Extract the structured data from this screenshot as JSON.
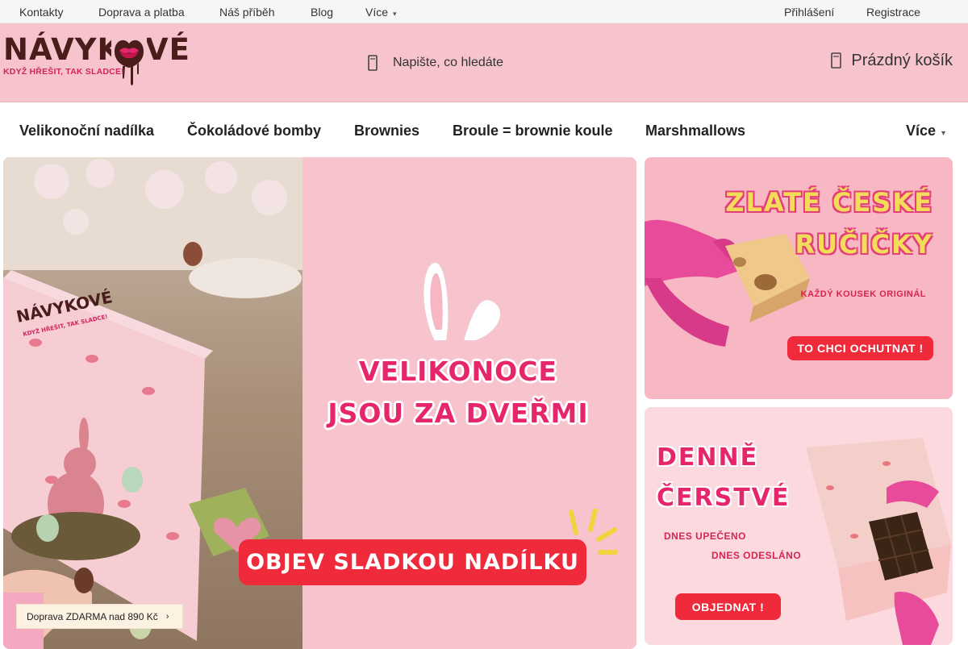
{
  "topbar": {
    "links": [
      "Kontakty",
      "Doprava a platba",
      "Náš příběh",
      "Blog"
    ],
    "more_label": "Více",
    "login_label": "Přihlášení",
    "register_label": "Registrace"
  },
  "header": {
    "logo_word": "NÁVYKOVÉ",
    "logo_tagline": "KDYŽ HŘEŠIT, TAK SLADCE!",
    "search_placeholder": "Napište, co hledáte",
    "cart_label": "Prázdný košík",
    "icons": {
      "search": "search-icon",
      "cart": "cart-icon",
      "chevron": "chevron-down-icon"
    }
  },
  "categories": {
    "items": [
      "Velikonoční nadílka",
      "Čokoládové bomby",
      "Brownies",
      "Broule = brownie koule",
      "Marshmallows"
    ],
    "more_label": "Více"
  },
  "hero": {
    "title_line1": "VELIKONOCE",
    "title_line2": "JSOU ZA DVEŘMI",
    "cta_label": "OBJEV SLADKOU NADÍLKU",
    "shipping_label": "Doprava ZDARMA nad 890 Kč",
    "box_brand": "NÁVYKOVÉ",
    "box_tagline": "KDYŽ HŘEŠIT, TAK SLADCE!"
  },
  "promo1": {
    "title_line1": "ZLATÉ ČESKÉ",
    "title_line2": "RUČIČKY",
    "subtitle": "KAŽDÝ KOUSEK ORIGINÁL",
    "cta_label": "TO CHCI OCHUTNAT !"
  },
  "promo2": {
    "title_line1": "DENNĚ",
    "title_line2": "ČERSTVÉ",
    "subtitle1": "DNES UPEČENO",
    "subtitle2": "DNES ODESLÁNO",
    "cta_label": "OBJEDNAT !"
  },
  "colors": {
    "header_bg": "#f7c4cd",
    "brand_brown": "#4a1d1a",
    "brand_pink": "#e6266a",
    "cta_red": "#ee2a3b"
  }
}
